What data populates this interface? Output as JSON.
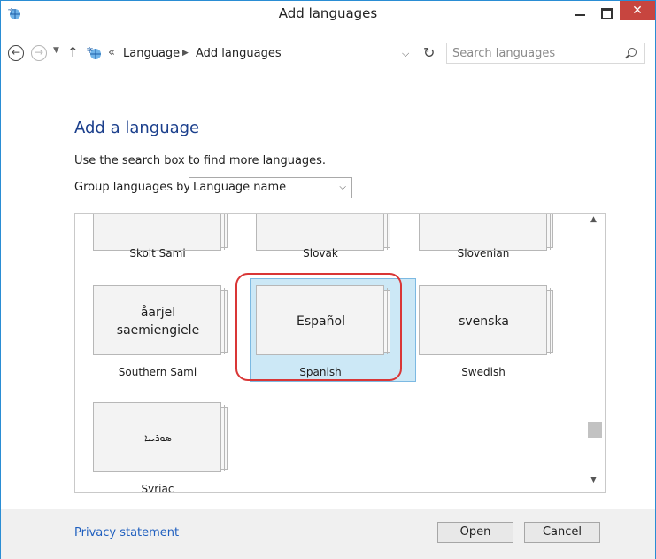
{
  "window": {
    "title": "Add languages"
  },
  "addressbar": {
    "breadcrumb": [
      "Language",
      "Add languages"
    ],
    "overflow_marker": "«",
    "search_placeholder": "Search languages"
  },
  "main": {
    "heading": "Add a language",
    "hint": "Use the search box to find more languages.",
    "group_label": "Group languages by:",
    "group_value": "Language name"
  },
  "tiles": [
    {
      "native": "",
      "name": "Skolt Sami"
    },
    {
      "native": "",
      "name": "Slovak"
    },
    {
      "native": "",
      "name": "Slovenian"
    },
    {
      "native": "åarjel saemiengiele",
      "name": "Southern Sami"
    },
    {
      "native": "Español",
      "name": "Spanish",
      "selected": true
    },
    {
      "native": "svenska",
      "name": "Swedish"
    },
    {
      "native": "ܣܘܪܝܝܐ",
      "name": "Syriac"
    }
  ],
  "footer": {
    "privacy_link": "Privacy statement",
    "open_label": "Open",
    "cancel_label": "Cancel"
  },
  "colors": {
    "accent": "#2a8dd4",
    "close": "#c7453f",
    "heading": "#1b3f8c",
    "selection": "#cce8f6",
    "highlight": "#d93636"
  }
}
